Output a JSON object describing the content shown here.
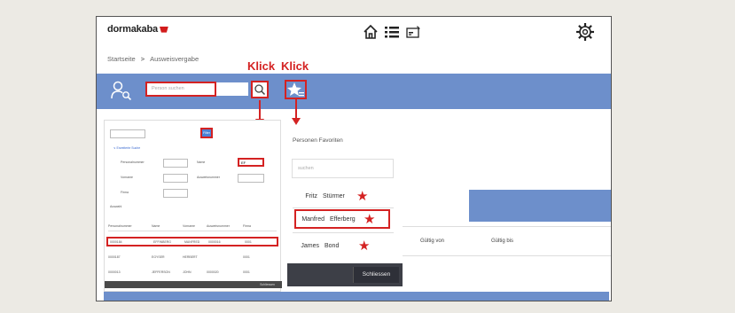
{
  "app": {
    "logo_text": "dormakaba"
  },
  "breadcrumb": {
    "home": "Startseite",
    "separator": ">",
    "current": "Ausweisvergabe"
  },
  "search": {
    "placeholder": "Person suchen"
  },
  "annotations": {
    "klick_1": "Klick",
    "klick_2": "Klick",
    "color": "#d42222"
  },
  "filter_panel": {
    "btn_label": "Filter",
    "expand_label": "Erweiterte Suche",
    "fields": [
      {
        "label": "Personalnummer",
        "value": ""
      },
      {
        "label": "Name",
        "value": "EF"
      },
      {
        "label": "Vorname",
        "value": ""
      },
      {
        "label": "Ausweisnummer",
        "value": ""
      },
      {
        "label": "Firma",
        "value": ""
      }
    ],
    "section_label": "Auswahl",
    "columns": [
      "Personalnummer",
      "Name",
      "Vorname",
      "Ausweisnummer",
      "Firma"
    ],
    "rows": [
      [
        "0000184",
        "EFFINBERG",
        "MANFRED",
        "0000016",
        "0001"
      ],
      [
        "0000187",
        "EGYSER",
        "HERBERT",
        "",
        "0001"
      ],
      [
        "0000013",
        "JEFFERSON",
        "JOHN",
        "0000020",
        "0001"
      ]
    ],
    "footer_label": "Schliessen"
  },
  "favorites": {
    "title": "Personen Favoriten",
    "search_placeholder": "suchen",
    "items": [
      {
        "first": "Fritz",
        "last": "Stürmer"
      },
      {
        "first": "Manfred",
        "last": "Efferberg"
      },
      {
        "first": "James",
        "last": "Bond"
      }
    ],
    "close_label": "Schliessen"
  },
  "table": {
    "col_valid_from": "Gültig von",
    "col_valid_to": "Gültig bis"
  },
  "colors": {
    "brand_blue": "#6d8fcb",
    "highlight_red": "#d42222"
  }
}
